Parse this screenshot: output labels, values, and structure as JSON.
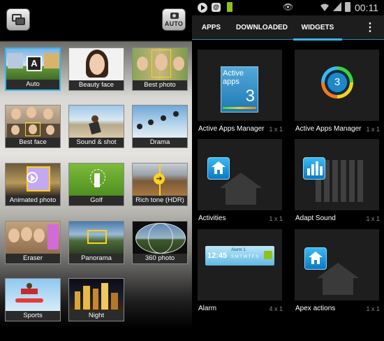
{
  "camera": {
    "auto_button_label": "AUTO",
    "modes": [
      {
        "label": "Auto",
        "selected": true
      },
      {
        "label": "Beauty face"
      },
      {
        "label": "Best photo"
      },
      {
        "label": "Best face"
      },
      {
        "label": "Sound & shot"
      },
      {
        "label": "Drama"
      },
      {
        "label": "Animated photo"
      },
      {
        "label": "Golf"
      },
      {
        "label": "Rich tone (HDR)"
      },
      {
        "label": "Eraser"
      },
      {
        "label": "Panorama"
      },
      {
        "label": "360 photo"
      },
      {
        "label": "Sports"
      },
      {
        "label": "Night"
      }
    ]
  },
  "statusbar": {
    "time": "00:11",
    "email_icon_letter": "@"
  },
  "tabs": {
    "apps": "APPS",
    "downloaded": "DOWNLOADED",
    "widgets": "WIDGETS",
    "menu": "⋮"
  },
  "widgets": [
    {
      "name": "Active Apps Manager",
      "size": "1 x 1",
      "preview_text": "Active apps",
      "preview_count": "3"
    },
    {
      "name": "Active Apps Manager",
      "size": "1 x 1",
      "preview_count": "3"
    },
    {
      "name": "Activities",
      "size": "1 x 1"
    },
    {
      "name": "Adapt Sound",
      "size": "1 x 1"
    },
    {
      "name": "Alarm",
      "size": "4 x 1",
      "preview_time": "12:45",
      "preview_alarm": "Alarm 1",
      "preview_days": "S M T W T F S"
    },
    {
      "name": "Apex actions",
      "size": "1 x 1"
    }
  ],
  "colors": {
    "accent": "#35b8e8",
    "battery_green": "#8ec21a"
  }
}
